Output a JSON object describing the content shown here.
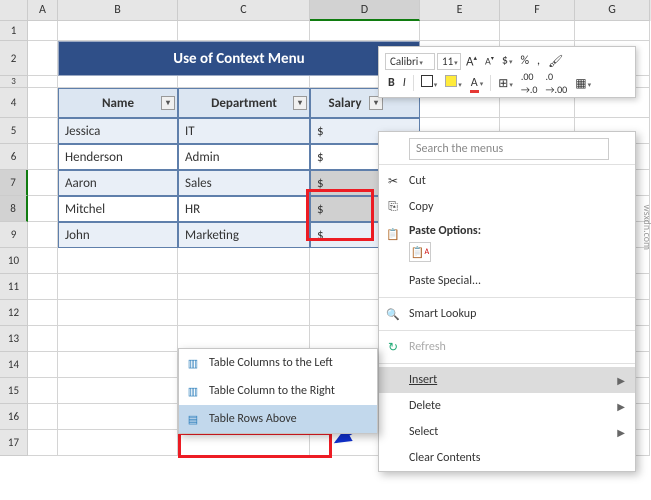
{
  "columns": [
    "A",
    "B",
    "C",
    "D",
    "E",
    "F",
    "G"
  ],
  "rows": [
    "1",
    "2",
    "3",
    "4",
    "5",
    "6",
    "7",
    "8",
    "9",
    "10",
    "11",
    "12",
    "13",
    "14",
    "15",
    "16",
    "17"
  ],
  "title": "Use of Context Menu",
  "table": {
    "headers": [
      "Name",
      "Department",
      "Salary"
    ],
    "rows": [
      {
        "name": "Jessica",
        "dept": "IT",
        "sal": "$"
      },
      {
        "name": "Henderson",
        "dept": "Admin",
        "sal": "$"
      },
      {
        "name": "Aaron",
        "dept": "Sales",
        "sal": "$"
      },
      {
        "name": "Mitchel",
        "dept": "HR",
        "sal": "$"
      },
      {
        "name": "John",
        "dept": "Marketing",
        "sal": "$"
      }
    ]
  },
  "mini": {
    "font": "Calibri",
    "size": "11",
    "incA": "A",
    "decA": "A",
    "currency": "$",
    "percent": "%",
    "comma": ",",
    "bold": "B",
    "italic": "I",
    "placeholder": "▼"
  },
  "ctx": {
    "search_placeholder": "Search the menus",
    "cut": "Cut",
    "copy": "Copy",
    "paste_options": "Paste Options:",
    "paste_special": "Paste Special...",
    "smart_lookup": "Smart Lookup",
    "refresh": "Refresh",
    "insert": "Insert",
    "delete": "Delete",
    "select": "Select",
    "clear": "Clear Contents"
  },
  "insert_sub": {
    "cols_left": "Table Columns to the Left",
    "cols_right": "Table Column to the Right",
    "rows_above": "Table Rows Above"
  },
  "watermark": "wsxdn.com"
}
